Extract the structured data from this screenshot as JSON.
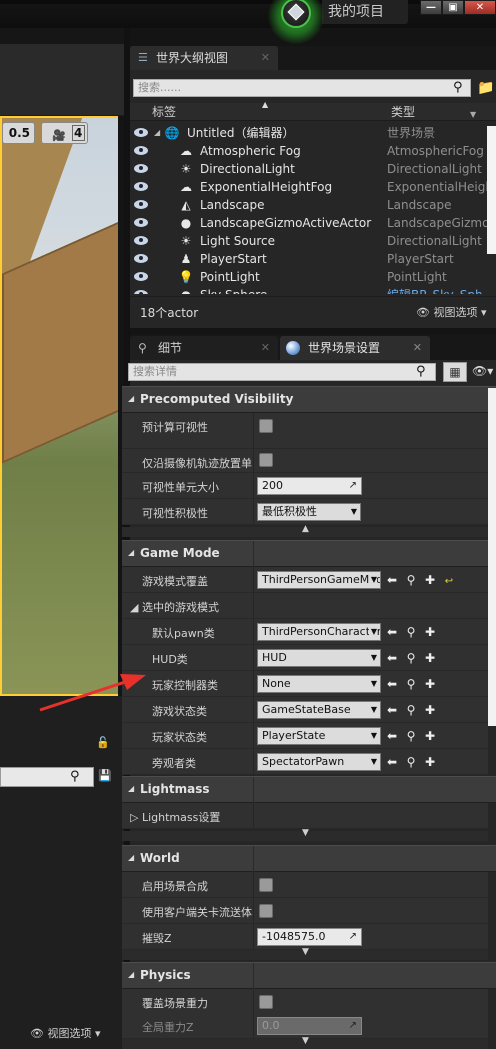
{
  "titlebar": {
    "project_name": "我的项目",
    "min": "—",
    "max": "▣",
    "close": "✕"
  },
  "viewport": {
    "snap_value": "0.5",
    "camera_speed": "4",
    "view_options": "视图选项",
    "accent": "#ffcc33"
  },
  "outliner": {
    "tab_label": "世界大纲视图",
    "search_placeholder": "搜索......",
    "col_label": "标签",
    "col_type": "类型",
    "root": {
      "name": "Untitled（编辑器）",
      "type": "世界场景"
    },
    "rows": [
      {
        "name": "Atmospheric Fog",
        "type": "AtmosphericFog",
        "icon": "☁"
      },
      {
        "name": "DirectionalLight",
        "type": "DirectionalLight",
        "icon": "☀"
      },
      {
        "name": "ExponentialHeightFog",
        "type": "ExponentialHeigh",
        "icon": "☁"
      },
      {
        "name": "Landscape",
        "type": "Landscape",
        "icon": "◭"
      },
      {
        "name": "LandscapeGizmoActiveActor",
        "type": "LandscapeGizmo",
        "icon": "●"
      },
      {
        "name": "Light Source",
        "type": "DirectionalLight",
        "icon": "☀"
      },
      {
        "name": "PlayerStart",
        "type": "PlayerStart",
        "icon": "♟"
      },
      {
        "name": "PointLight",
        "type": "PointLight",
        "icon": "💡"
      },
      {
        "name": "Sky Sphere",
        "type": "编辑BP_Sky_Sph",
        "icon": "●"
      }
    ],
    "actor_count": "18个actor",
    "view_options": "视图选项"
  },
  "details": {
    "tab_details": "细节",
    "tab_world": "世界场景设置",
    "search_placeholder": "搜索详情",
    "precomputed": {
      "title": "Precomputed Visibility",
      "precompute_label": "预计算可视性",
      "camera_track_label": "仅沿摄像机轨迹放置单",
      "cell_size_label": "可视性单元大小",
      "cell_size_value": "200",
      "aggressiveness_label": "可视性积极性",
      "aggressiveness_value": "最低积极性"
    },
    "gamemode": {
      "title": "Game Mode",
      "override_label": "游戏模式覆盖",
      "override_value": "ThirdPersonGameMode",
      "selected_label": "选中的游戏模式",
      "pawn_label": "默认pawn类",
      "pawn_value": "ThirdPersonCharacter",
      "hud_label": "HUD类",
      "hud_value": "HUD",
      "pc_label": "玩家控制器类",
      "pc_value": "None",
      "gs_label": "游戏状态类",
      "gs_value": "GameStateBase",
      "ps_label": "玩家状态类",
      "ps_value": "PlayerState",
      "spec_label": "旁观者类",
      "spec_value": "SpectatorPawn"
    },
    "lightmass": {
      "title": "Lightmass",
      "settings_label": "Lightmass设置"
    },
    "world": {
      "title": "World",
      "composition_label": "启用场景合成",
      "client_stream_label": "使用客户端关卡流送体",
      "kill_z_label": "摧毁Z",
      "kill_z_value": "-1048575.0"
    },
    "physics": {
      "title": "Physics",
      "override_gravity_label": "覆盖场景重力",
      "global_gravity_label": "全局重力Z",
      "global_gravity_value": "0.0"
    }
  }
}
